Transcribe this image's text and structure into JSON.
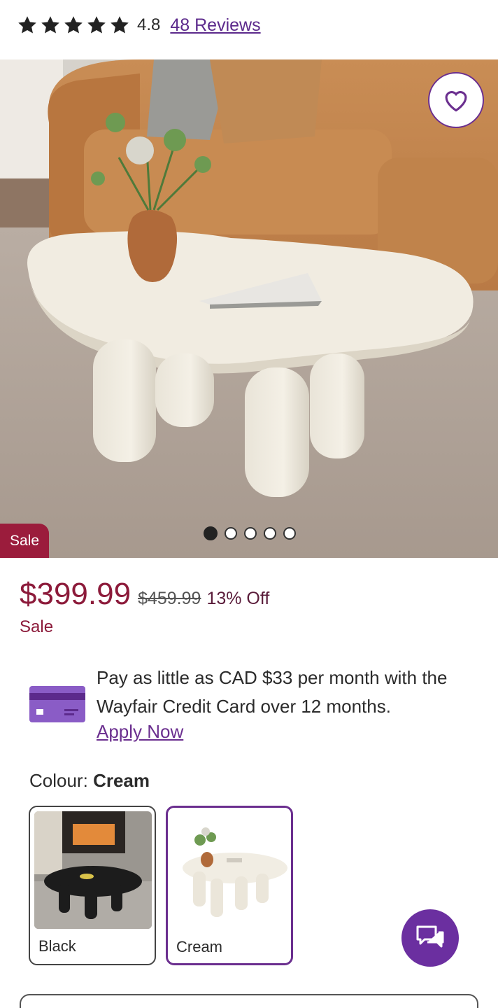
{
  "rating": {
    "stars": 5,
    "value": "4.8",
    "reviews_link": "48 Reviews"
  },
  "hero": {
    "favorite_icon": "heart-icon",
    "sale_badge": "Sale",
    "image_count": 5,
    "active_image": 1
  },
  "price": {
    "current": "$399.99",
    "original": "$459.99",
    "discount": "13% Off",
    "sale_label": "Sale"
  },
  "promo": {
    "icon": "credit-card-icon",
    "text": "Pay as little as CAD $33 per month with the Wayfair Credit Card over 12 months.",
    "apply_link": "Apply Now"
  },
  "colour": {
    "label": "Colour:",
    "selected": "Cream",
    "options": [
      {
        "label": "Black"
      },
      {
        "label": "Cream"
      }
    ]
  },
  "chat": {
    "icon": "chat-icon"
  },
  "colors": {
    "brand_purple": "#6b2f8f",
    "sale_red": "#9b1c3c",
    "price_red": "#8c1a3a"
  }
}
